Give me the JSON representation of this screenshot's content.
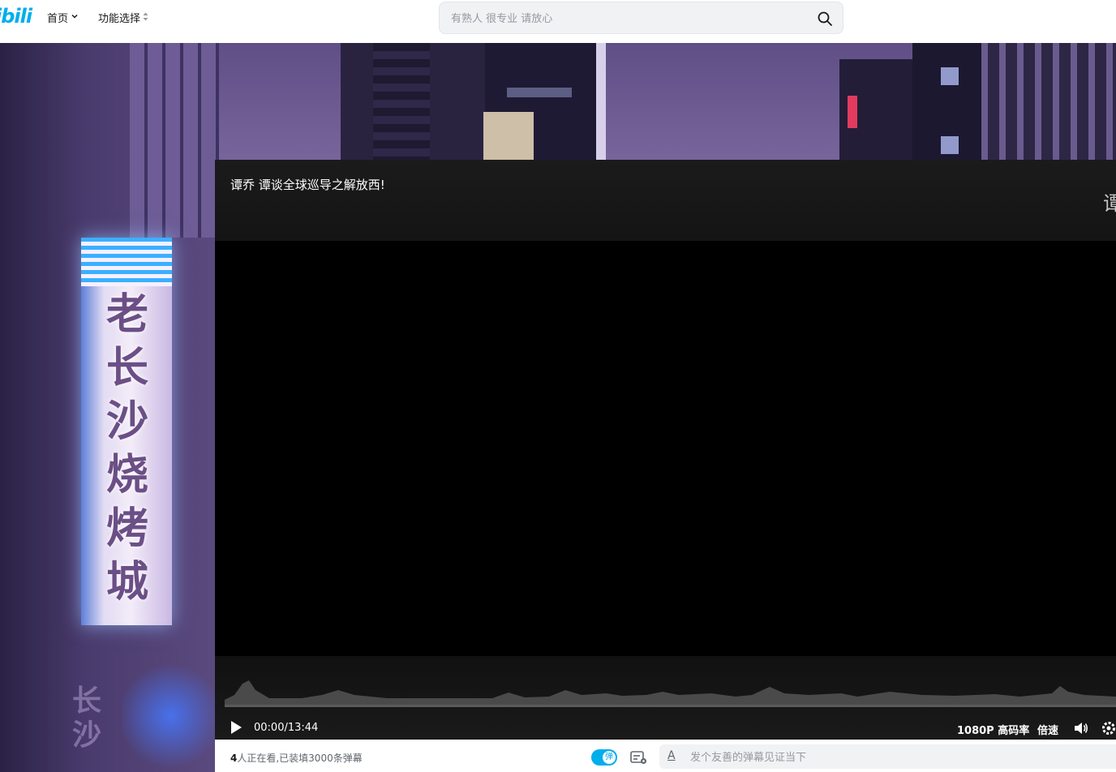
{
  "header": {
    "logo_text": "ibili",
    "nav": [
      {
        "label": "首页",
        "icon": "chevron-down-icon"
      },
      {
        "label": "功能选择",
        "icon": "sort-icon"
      }
    ],
    "search_placeholder": "有熟人 很专业 请放心",
    "search_icon": "search-icon"
  },
  "background": {
    "sign_text": "老长沙烧烤城",
    "sign2_text": "长沙"
  },
  "player": {
    "title": "谭乔 谭谈全球巡导之解放西!",
    "side_char": "谭",
    "progress": 0,
    "time": "00:00/13:44",
    "quality": "1080P 高码率",
    "speed": "倍速"
  },
  "danmaku": {
    "viewers_count": "4",
    "viewers_text": "人正在看,已装填3000条弹幕",
    "toggle_label": "弹",
    "toggle_on": true,
    "input_placeholder": "发个友善的弹幕见证当下",
    "accent": "#00aeec"
  }
}
